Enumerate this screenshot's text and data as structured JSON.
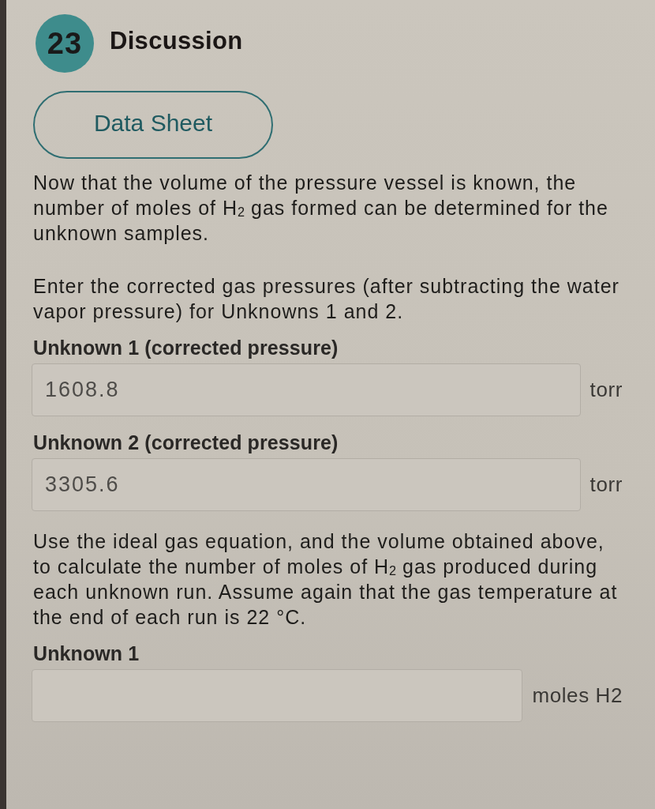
{
  "header": {
    "step_number": "23",
    "title": "Discussion"
  },
  "data_sheet_button": {
    "label": "Data Sheet"
  },
  "content": [
    {
      "kind": "paragraph",
      "text": "Now that the volume of the pressure vessel is known, the number of moles of H$_{2}$ gas formed can be determined for the unknown samples."
    },
    {
      "kind": "paragraph",
      "text": "Enter the corrected gas pressures (after subtracting the water vapor pressure) for Unknowns 1 and 2."
    },
    {
      "kind": "field",
      "label": "Unknown 1 (corrected pressure)",
      "value": "1608.8",
      "unit": "torr"
    },
    {
      "kind": "field",
      "label": "Unknown 2 (corrected pressure)",
      "value": "3305.6",
      "unit": "torr"
    },
    {
      "kind": "paragraph",
      "text": "Use the ideal gas equation, and the volume obtained above, to calculate the number of moles of H$_{2}$ gas produced during each unknown run. Assume again that the gas temperature at the end of each run is 22 °C."
    },
    {
      "kind": "field",
      "label": "Unknown 1",
      "unit": "moles H2"
    }
  ]
}
